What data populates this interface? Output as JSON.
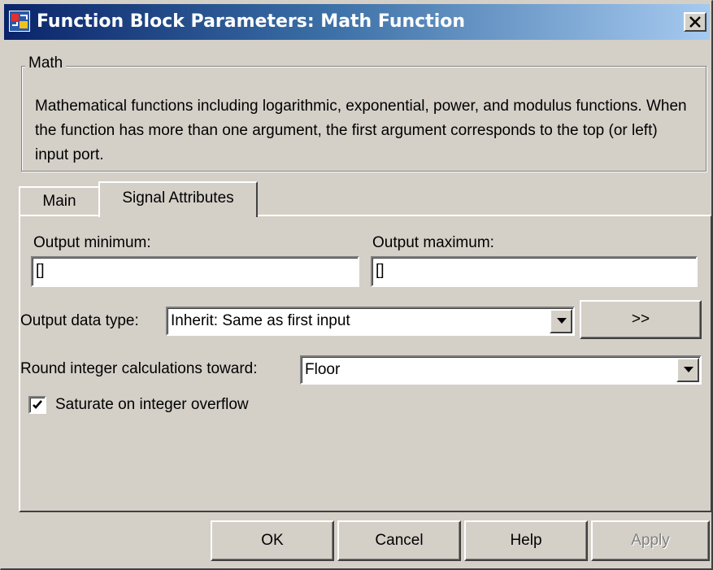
{
  "window": {
    "title": "Function Block Parameters: Math Function",
    "title_icon": "simulink-block-icon",
    "close_icon": "close-icon"
  },
  "math_group": {
    "legend": "Math",
    "description": "Mathematical functions including logarithmic, exponential, power, and modulus functions.  When the function has more than one argument, the first argument corresponds to the top (or left) input port."
  },
  "tabs": [
    {
      "label": "Main",
      "selected": false
    },
    {
      "label": "Signal Attributes",
      "selected": true
    }
  ],
  "signal_attributes": {
    "output_minimum_label": "Output minimum:",
    "output_minimum_value": "[]",
    "output_maximum_label": "Output maximum:",
    "output_maximum_value": "[]",
    "output_data_type_label": "Output data type:",
    "output_data_type_value": "Inherit: Same as first input",
    "data_type_assistant_button": ">>",
    "round_label": "Round integer calculations toward:",
    "round_value": "Floor",
    "saturate_label": "Saturate on integer overflow",
    "saturate_checked": true
  },
  "buttons": {
    "ok": "OK",
    "cancel": "Cancel",
    "help": "Help",
    "apply": "Apply"
  },
  "colors": {
    "dialog_face": "#d4d0c8",
    "title_gradient_start": "#0a246a",
    "title_gradient_end": "#a6caf0",
    "disabled_text": "#808080"
  }
}
